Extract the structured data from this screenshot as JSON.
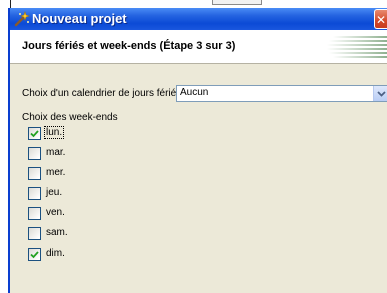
{
  "window": {
    "title": "Nouveau projet",
    "close_glyph": "✕"
  },
  "header": {
    "step_title": "Jours fériés et week-ends  (Étape 3 sur 3)"
  },
  "holiday_calendar": {
    "label": "Choix d'un calendrier de jours fériés",
    "selected": "Aucun"
  },
  "weekends": {
    "label": "Choix des week-ends",
    "days": [
      {
        "label": "lun.",
        "checked": true,
        "focused": true
      },
      {
        "label": "mar.",
        "checked": false,
        "focused": false
      },
      {
        "label": "mer.",
        "checked": false,
        "focused": false
      },
      {
        "label": "jeu.",
        "checked": false,
        "focused": false
      },
      {
        "label": "ven.",
        "checked": false,
        "focused": false
      },
      {
        "label": "sam.",
        "checked": false,
        "focused": false
      },
      {
        "label": "dim.",
        "checked": true,
        "focused": false
      }
    ]
  },
  "colors": {
    "titlebar": "#0b4ad6",
    "dialog_bg": "#ece9d8",
    "checkmark": "#21a121",
    "close_button": "#d4492a"
  },
  "icons": {
    "title": "wizard-wand-icon",
    "close": "close-icon",
    "dropdown": "chevron-down-icon",
    "check": "check-icon"
  }
}
